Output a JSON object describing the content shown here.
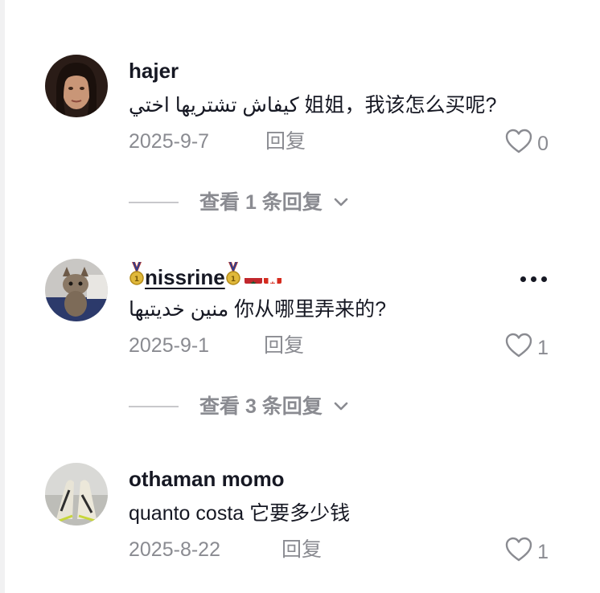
{
  "comments": [
    {
      "username": "hajer",
      "text": "كيفاش تشتريها اختي  姐姐，我该怎么买呢?",
      "date": "2025-9-7",
      "reply_label": "回复",
      "like_count": "0",
      "view_replies_label": "查看 1 条回复"
    },
    {
      "username": "nissrine",
      "text": "منين خديتيها  你从哪里弄来的?",
      "date": "2025-9-1",
      "reply_label": "回复",
      "like_count": "1",
      "view_replies_label": "查看 3 条回复"
    },
    {
      "username": "othaman momo",
      "text": "quanto costa  它要多少钱",
      "date": "2025-8-22",
      "reply_label": "回复",
      "like_count": "1"
    }
  ],
  "colors": {
    "primary_text": "#161823",
    "secondary_text": "#8a8b91",
    "divider": "#c8c8cb"
  },
  "icons": [
    "heart-outline-icon",
    "chevron-down-icon",
    "more-dots-icon",
    "medal-icon",
    "morocco-flag-icon",
    "canada-flag-icon"
  ]
}
